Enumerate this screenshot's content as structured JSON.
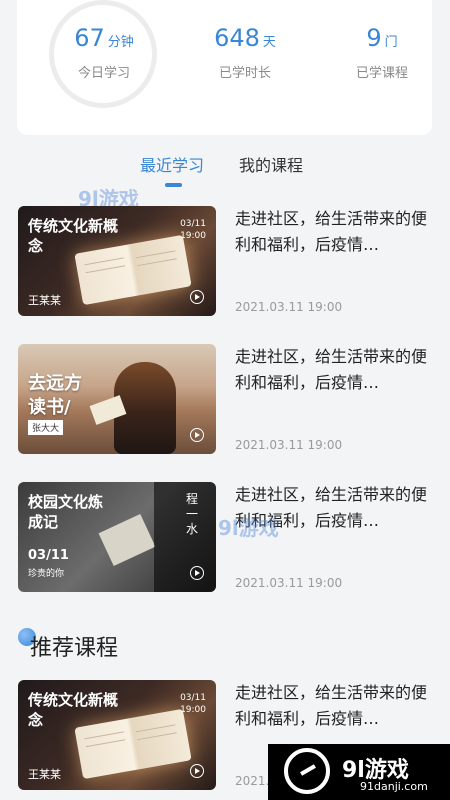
{
  "stats": [
    {
      "value": "67",
      "unit": "分钟",
      "label": "今日学习"
    },
    {
      "value": "648",
      "unit": "天",
      "label": "已学时长"
    },
    {
      "value": "9",
      "unit": "门",
      "label": "已学课程"
    }
  ],
  "tabs": {
    "recent": "最近学习",
    "mine": "我的课程"
  },
  "courses": [
    {
      "thumb_title": "传统文化新概念",
      "thumb_date": "03/11",
      "thumb_time": "19:00",
      "author": "王某某",
      "desc": "走进社区，给生活带来的便利和福利，后疫情…",
      "time": "2021.03.11 19:00"
    },
    {
      "thumb_title_line1": "去远方",
      "thumb_title_line2": "读书/",
      "author": "张大大",
      "desc": "走进社区，给生活带来的便利和福利，后疫情…",
      "time": "2021.03.11 19:00"
    },
    {
      "thumb_title": "校园文化炼成记",
      "thumb_vertical": "程一水",
      "thumb_date": "03/11",
      "thumb_sub": "珍贵的你",
      "desc": "走进社区，给生活带来的便利和福利，后疫情…",
      "time": "2021.03.11 19:00"
    }
  ],
  "recommend": {
    "title": "推荐课程",
    "course": {
      "thumb_title": "传统文化新概念",
      "thumb_date": "03/11",
      "thumb_time": "19:00",
      "author": "王某某",
      "desc": "走进社区，给生活带来的便利和福利，后疫情…",
      "time": "2021.03.1"
    }
  },
  "watermark": {
    "logo": "9l游戏",
    "url": "91danji.com"
  },
  "colors": {
    "accent": "#3a86d6",
    "text": "#222222",
    "muted": "#9a9a9a",
    "background": "#f3f4f6"
  }
}
